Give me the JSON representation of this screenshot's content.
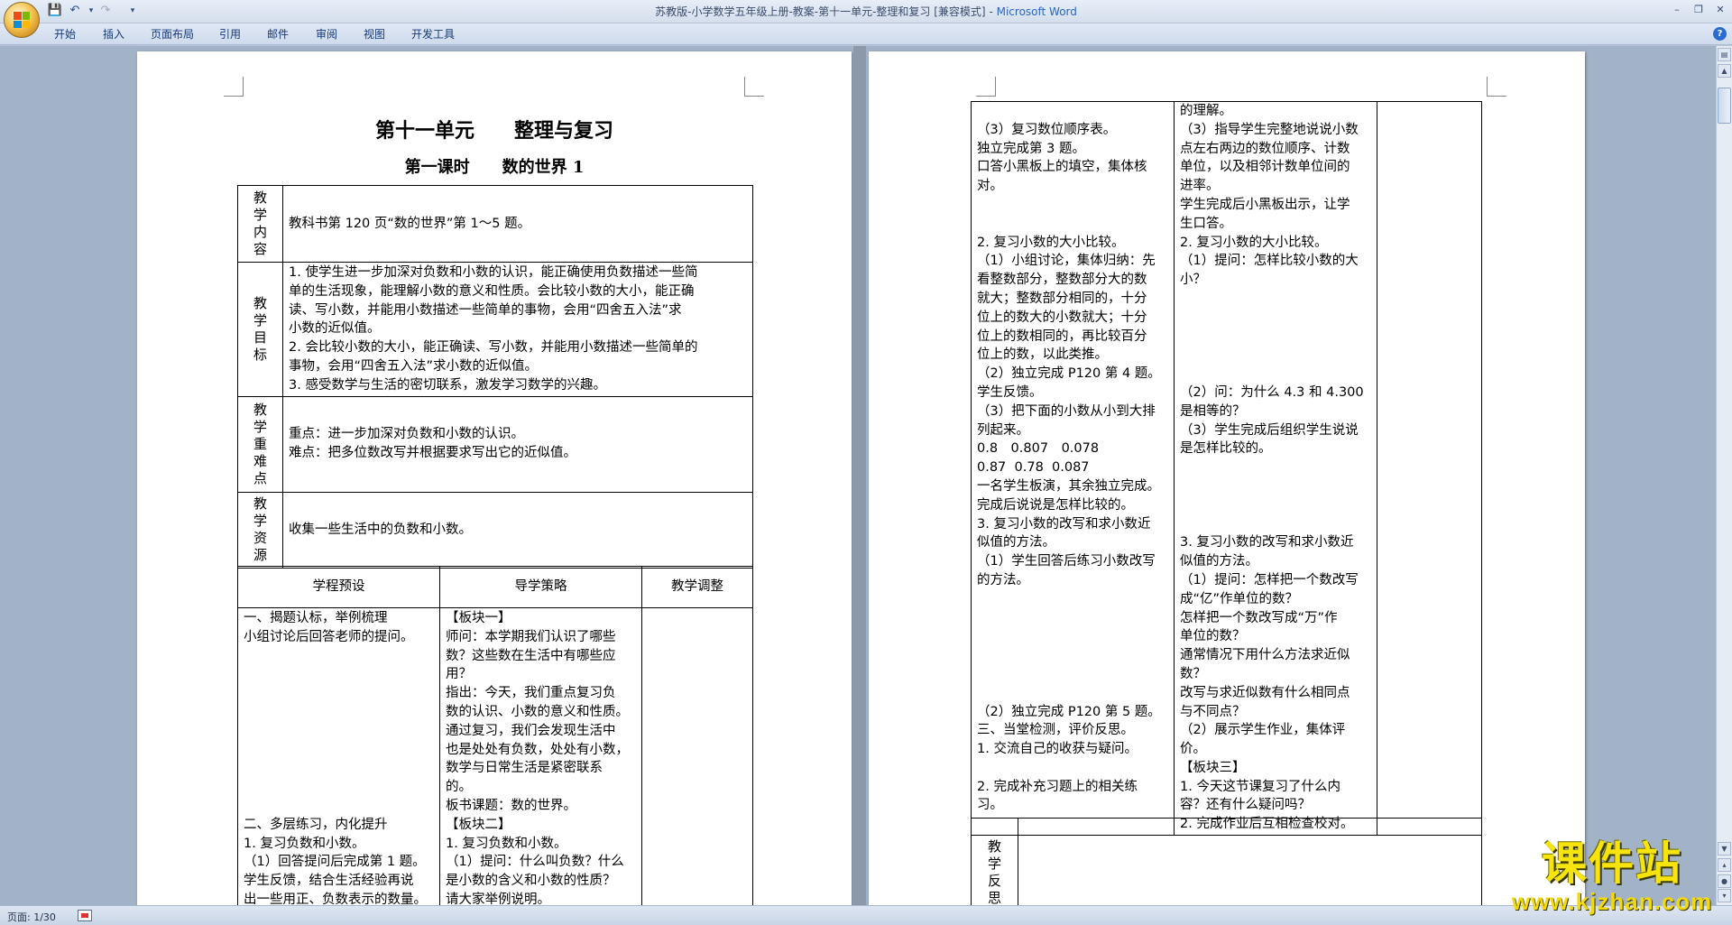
{
  "window": {
    "title": "苏教版-小学数学五年级上册-教案-第十一单元-整理和复习 [兼容模式]",
    "app_name": "Microsoft Word"
  },
  "quick_access": [
    "save-icon",
    "undo-icon",
    "redo-icon",
    "customize-icon"
  ],
  "ribbon_tabs": [
    "开始",
    "插入",
    "页面布局",
    "引用",
    "邮件",
    "审阅",
    "视图",
    "开发工具"
  ],
  "page1": {
    "title": "第十一单元　　整理与复习",
    "subtitle": "第一课时　　数的世界 1",
    "rows": [
      {
        "label": [
          "教",
          "学",
          "内",
          "容"
        ],
        "content": [
          "教科书第 120 页“数的世界”第 1～5 题。"
        ]
      },
      {
        "label": [
          "教",
          "学",
          "目",
          "标"
        ],
        "content": [
          "1. 使学生进一步加深对负数和小数的认识，能正确使用负数描述一些简",
          "单的生活现象，能理解小数的意义和性质。会比较小数的大小，能正确",
          "读、写小数，并能用小数描述一些简单的事物，会用“四舍五入法”求",
          "小数的近似值。",
          "2. 会比较小数的大小，能正确读、写小数，并能用小数描述一些简单的",
          "事物，会用“四舍五入法”求小数的近似值。",
          "3. 感受数学与生活的密切联系，激发学习数学的兴趣。"
        ]
      },
      {
        "label": [
          "教",
          "学",
          "重",
          "难",
          "点"
        ],
        "content": [
          "重点：进一步加深对负数和小数的认识。",
          "难点：把多位数改写并根据要求写出它的近似值。"
        ]
      },
      {
        "label": [
          "教",
          "学",
          "资",
          "源"
        ],
        "content": [
          "收集一些生活中的负数和小数。"
        ]
      }
    ],
    "process_headers": [
      "学程预设",
      "导学策略",
      "教学调整"
    ],
    "col1": [
      "一、揭题认标，举例梳理",
      "小组讨论后回答老师的提问。",
      "",
      "",
      "",
      "",
      "",
      "",
      "",
      "",
      "",
      "二、多层练习，内化提升",
      "1. 复习负数和小数。",
      "（1）回答提问后完成第 1 题。",
      "学生反馈，结合生活经验再说",
      "出一些用正、负数表示的数量。"
    ],
    "col2": [
      "【板块一】",
      "师问：本学期我们认识了哪些",
      "数？这些数在生活中有哪些应",
      "用？",
      "指出：今天，我们重点复习负",
      "数的认识、小数的意义和性质。",
      "通过复习，我们会发现生活中",
      "也是处处有负数，处处有小数，",
      "数学与日常生活是紧密联系",
      "的。",
      "板书课题：数的世界。",
      "【板块二】",
      "1. 复习负数和小数。",
      "（1）提问：什么叫负数？什么",
      "是小数的含义和小数的性质？",
      "请大家举例说明。"
    ]
  },
  "page2": {
    "col1": [
      "",
      "（3）复习数位顺序表。",
      "独立完成第 3 题。",
      "口答小黑板上的填空，集体核",
      "对。",
      "",
      "",
      "2. 复习小数的大小比较。",
      "（1）小组讨论，集体归纳：先",
      "看整数部分，整数部分大的数",
      "就大；整数部分相同的，十分",
      "位上的数大的小数就大；十分",
      "位上的数相同的，再比较百分",
      "位上的数，以此类推。",
      "（2）独立完成 P120 第 4 题。",
      "学生反馈。",
      "（3）把下面的小数从小到大排",
      "列起来。",
      "0.8　0.807　0.078",
      "0.87  0.78  0.087",
      "一名学生板演，其余独立完成。",
      "完成后说说是怎样比较的。",
      "3. 复习小数的改写和求小数近",
      "似值的方法。",
      "（1）学生回答后练习小数改写",
      "的方法。",
      "",
      "",
      "",
      "",
      "",
      "",
      "（2）独立完成 P120 第 5 题。",
      "三、当堂检测，评价反思。",
      "1. 交流自己的收获与疑问。",
      "",
      "2. 完成补充习题上的相关练",
      "习。"
    ],
    "col2": [
      "的理解。",
      "（3）指导学生完整地说说小数",
      "点左右两边的数位顺序、计数",
      "单位，以及相邻计数单位间的",
      "进率。",
      "学生完成后小黑板出示，让学",
      "生口答。",
      "2. 复习小数的大小比较。",
      "（1）提问：怎样比较小数的大",
      "小？",
      "",
      "",
      "",
      "",
      "",
      "（2）问：为什么 4.3 和 4.300",
      "是相等的？",
      "（3）学生完成后组织学生说说",
      "是怎样比较的。",
      "",
      "",
      "",
      "",
      "3. 复习小数的改写和求小数近",
      "似值的方法。",
      "（1）提问：怎样把一个数改写",
      "成“亿”作单位的数？",
      "怎样把一个数改写成“万”作",
      "单位的数？",
      "通常情况下用什么方法求近似",
      "数？",
      "改写与求近似数有什么相同点",
      "与不同点？",
      "（2）展示学生作业，集体评价。",
      "【板块三】",
      "1. 今天这节课复习了什么内",
      "容？还有什么疑问吗？",
      "2. 完成作业后互相检查校对。"
    ],
    "reflection_label": [
      "教",
      "学",
      "反",
      "思"
    ]
  },
  "status": {
    "page_label": "页面: 1/30"
  },
  "watermark": {
    "title": "课件站",
    "url": "www.kjzhan.com"
  }
}
